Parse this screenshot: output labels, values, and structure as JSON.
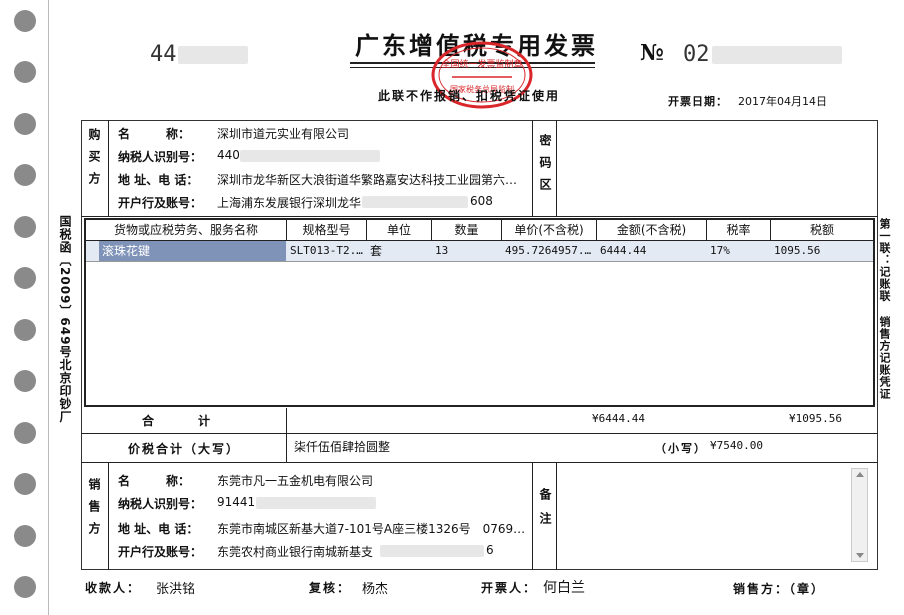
{
  "header": {
    "title": "广东增值税专用发票",
    "code_prefix": "44",
    "number_symbol": "№",
    "number_prefix": "02",
    "subtitle": "此联不作报销、扣税凭证使用",
    "date_label": "开票日期：",
    "date_value": "2017年04月14日",
    "stamp_text": [
      "全国统一发票监制章",
      "国家税务总局监制"
    ]
  },
  "side": {
    "left_note": "国税函〔2009〕649号北京印钞厂",
    "right_note": "第一联：记账联 销售方记账凭证"
  },
  "buyer": {
    "section_label": "购买方",
    "name_label": "名　　　称：",
    "name_value": "深圳市道元实业有限公司",
    "taxid_label": "纳税人识别号：",
    "taxid_value": "440",
    "addr_label": "地 址、电 话：",
    "addr_value": "深圳市龙华新区大浪街道华繁路嘉安达科技工业园第六…",
    "bank_label": "开户行及账号：",
    "bank_value": "上海浦东发展银行深圳龙华",
    "bank_suffix": "608",
    "cipher_label": "密码区"
  },
  "items": {
    "headers": [
      "货物或应税劳务、服务名称",
      "规格型号",
      "单位",
      "数量",
      "单价(不含税)",
      "金额(不含税)",
      "税率",
      "税额"
    ],
    "rows": [
      [
        "滚珠花键",
        "SLT013-T2...",
        "套",
        "13",
        "495.7264957...",
        "6444.44",
        "17%",
        "1095.56"
      ]
    ]
  },
  "totals": {
    "label": "合　　　计",
    "amount": "¥6444.44",
    "tax": "¥1095.56",
    "big_label": "价税合计（大写）",
    "big_value": "柒仟伍佰肆拾圆整",
    "small_label": "（小写）",
    "small_value": "¥7540.00"
  },
  "seller": {
    "section_label": "销售方",
    "name_label": "名　　　称：",
    "name_value": "东莞市凡一五金机电有限公司",
    "taxid_label": "纳税人识别号：",
    "taxid_value": "91441",
    "addr_label": "地 址、电 话：",
    "addr_value": "东莞市南城区新基大道7-101号A座三楼1326号　0769-…",
    "bank_label": "开户行及账号：",
    "bank_value": "东莞农村商业银行南城新基支",
    "bank_suffix": "6",
    "remark_label": "备注"
  },
  "footer": {
    "payee_label": "收款人：",
    "payee_value": "张洪铭",
    "reviewer_label": "复核：",
    "reviewer_value": "杨杰",
    "drawer_label": "开票人：",
    "drawer_value": "何白兰",
    "seller_seal_label": "销售方：（章）"
  },
  "colors": {
    "stamp": "#d9262b",
    "row_selected": "#7f93b8",
    "row_bg": "#e4eaf4"
  }
}
